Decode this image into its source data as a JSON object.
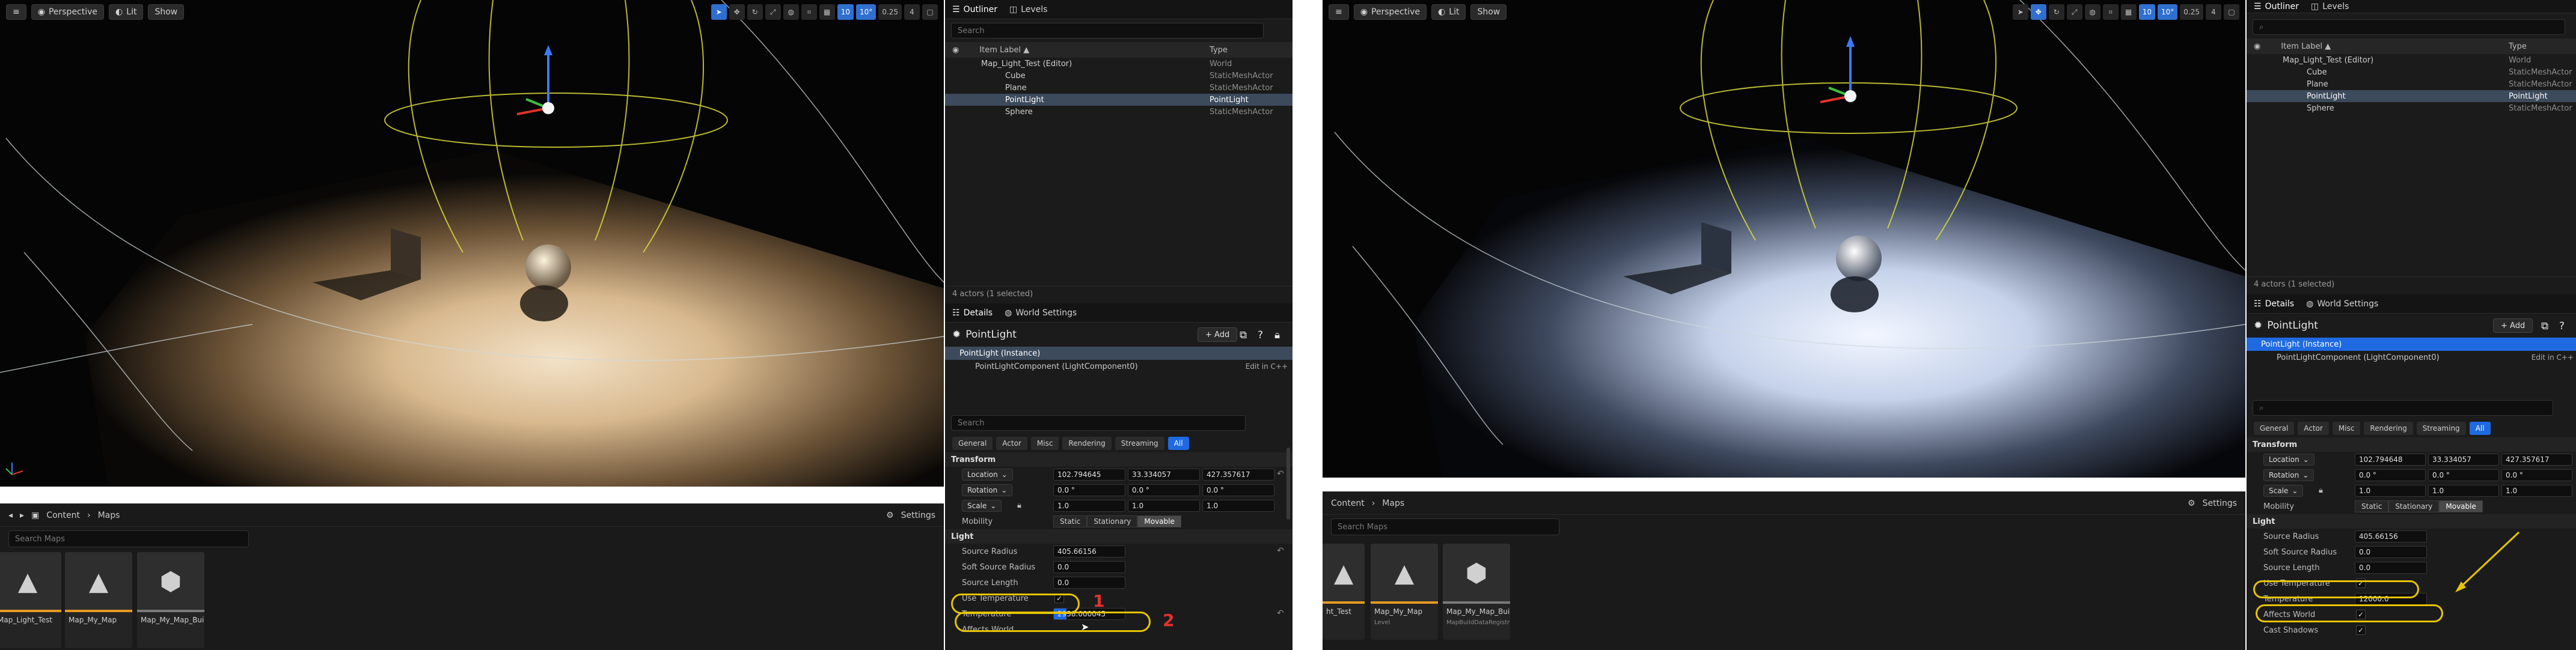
{
  "viewport": {
    "perspective_label": "Perspective",
    "lit_label": "Lit",
    "show_label": "Show",
    "tool_values": [
      "10",
      "10°",
      "0.25",
      "4"
    ]
  },
  "content_browser": {
    "content_label": "Content",
    "maps_label": "Maps",
    "settings_label": "Settings",
    "search_placeholder": "Search Maps",
    "assets_left": [
      {
        "label": "Map_Light_Test",
        "sub": ""
      },
      {
        "label": "Map_My_Map",
        "sub": ""
      },
      {
        "label": "Map_My_Map_BuiltData",
        "sub": ""
      }
    ],
    "assets_right": [
      {
        "label": "ht_Test",
        "sub": ""
      },
      {
        "label": "Map_My_Map",
        "sub": "Level"
      },
      {
        "label": "Map_My_Map_BuiltData",
        "sub": "MapBuildDataRegistry"
      }
    ]
  },
  "outliner": {
    "tab_outliner": "Outliner",
    "tab_levels": "Levels",
    "search_placeholder": "Search",
    "col_label": "Item Label ▲",
    "col_type": "Type",
    "rows": [
      {
        "label": "Map_Light_Test (Editor)",
        "type": "World"
      },
      {
        "label": "Cube",
        "type": "StaticMeshActor"
      },
      {
        "label": "Plane",
        "type": "StaticMeshActor"
      },
      {
        "label": "PointLight",
        "type": "PointLight"
      },
      {
        "label": "Sphere",
        "type": "StaticMeshActor"
      }
    ],
    "status": "4 actors (1 selected)"
  },
  "details": {
    "tab_details": "Details",
    "tab_world_settings": "World Settings",
    "title": "PointLight",
    "add_label": "+ Add",
    "instance_label": "PointLight (Instance)",
    "component_label": "PointLightComponent (LightComponent0)",
    "edit_cpp": "Edit in C++",
    "search_placeholder": "Search",
    "filters": [
      "General",
      "Actor",
      "Misc",
      "Rendering",
      "Streaming",
      "All"
    ],
    "transform_section": "Transform",
    "location_label": "Location",
    "rotation_label": "Rotation",
    "scale_label": "Scale",
    "location": [
      "102.794645",
      "33.334057",
      "427.357617"
    ],
    "location_right": [
      "102.794648",
      "33.334057",
      "427.357617"
    ],
    "rotation": [
      "0.0 °",
      "0.0 °",
      "0.0 °"
    ],
    "scale": [
      "1.0",
      "1.0",
      "1.0"
    ],
    "mobility_label": "Mobility",
    "mobility_options": [
      "Static",
      "Stationary",
      "Movable"
    ],
    "light_section": "Light",
    "source_radius_label": "Source Radius",
    "source_radius": "405.66156",
    "soft_source_radius_label": "Soft Source Radius",
    "soft_source_radius": "0.0",
    "source_length_label": "Source Length",
    "source_length": "0.0",
    "use_temperature_label": "Use Temperature",
    "temperature_label": "Temperature",
    "temperature_left": "2958.000045",
    "temperature_right": "12000.0",
    "affects_world_label": "Affects World",
    "cast_shadows_label": "Cast Shadows",
    "annotation_1": "1",
    "annotation_2": "2"
  },
  "colors": {
    "highlight": "#e6c400",
    "annotation_number": "#e53030",
    "selection_blue": "#1f6ae0"
  }
}
